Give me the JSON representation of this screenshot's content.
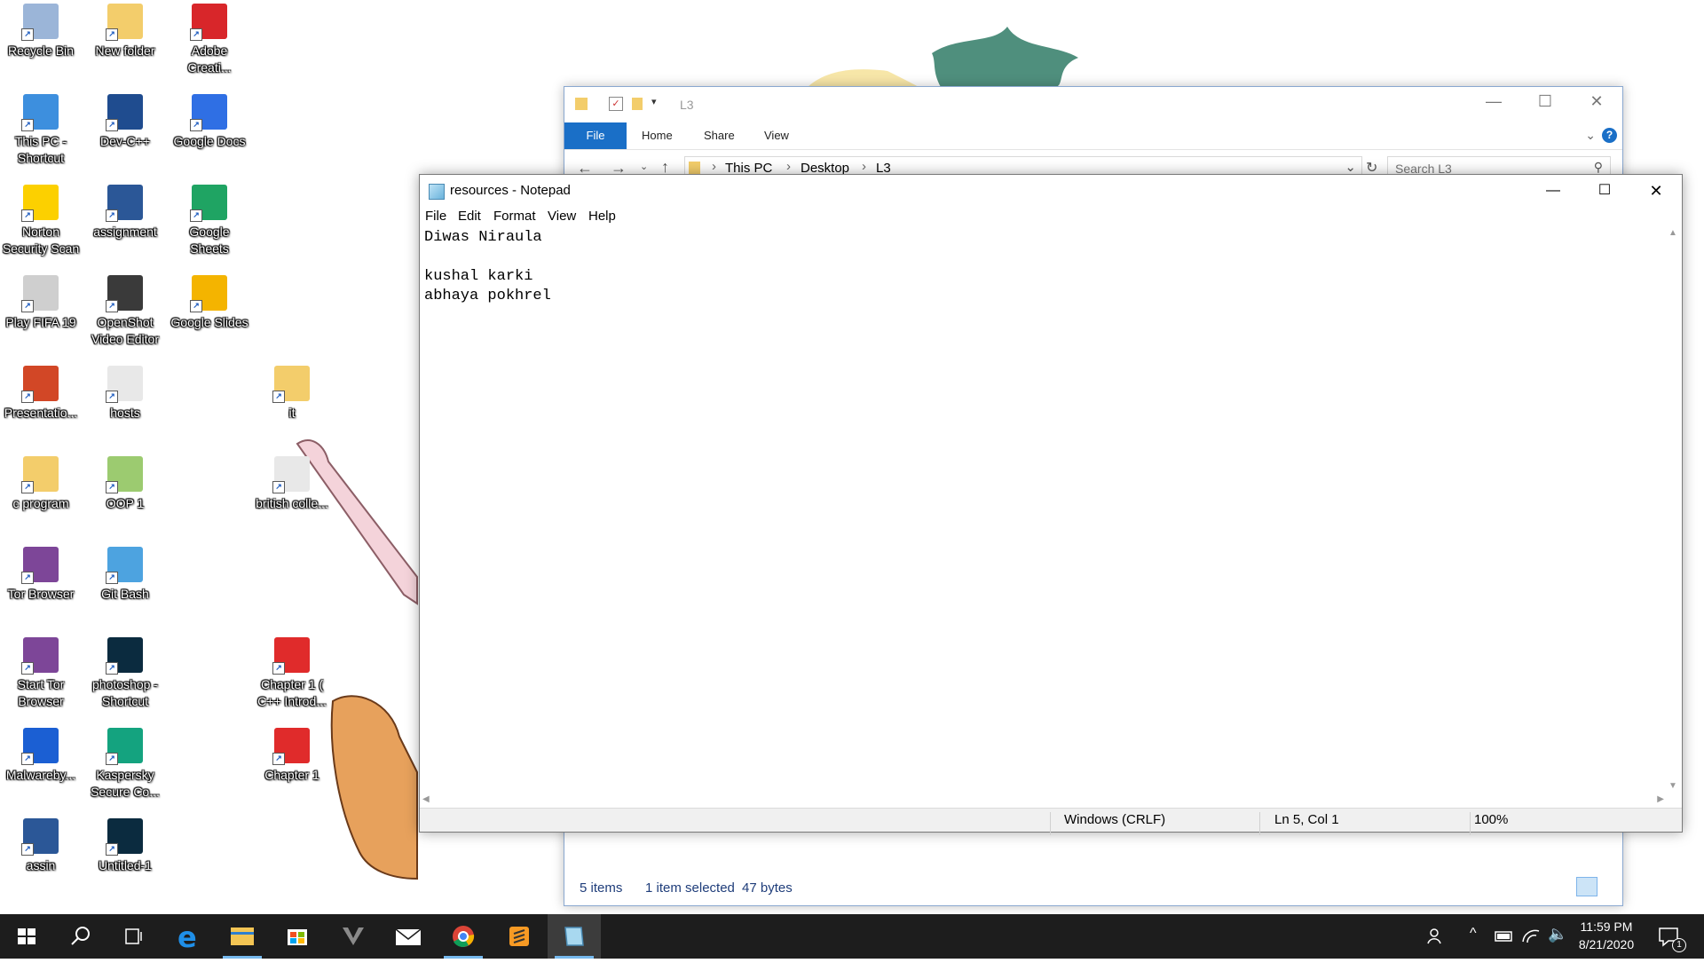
{
  "desktop": {
    "icons": [
      {
        "label": "Recycle Bin",
        "icon": "recycle-bin-icon",
        "color": "#9bb5d8"
      },
      {
        "label": "New folder",
        "icon": "folder-icon",
        "color": "#f3cd6b"
      },
      {
        "label": "Adobe Creati...",
        "icon": "adobe-creative-cloud-icon",
        "color": "#d8262a"
      },
      {
        "label": "This PC - Shortcut",
        "icon": "this-pc-icon",
        "color": "#3d8fde"
      },
      {
        "label": "Dev-C++",
        "icon": "dev-cpp-icon",
        "color": "#1f4c8f"
      },
      {
        "label": "Google Docs",
        "icon": "google-docs-icon",
        "color": "#2f6fe4"
      },
      {
        "label": "Norton Security Scan",
        "icon": "norton-icon",
        "color": "#fcd000"
      },
      {
        "label": "assignment",
        "icon": "word-document-icon",
        "color": "#2b5797"
      },
      {
        "label": "Google Sheets",
        "icon": "google-sheets-icon",
        "color": "#1fa463"
      },
      {
        "label": "Play FIFA 19",
        "icon": "fifa-icon",
        "color": "#cfcfcf"
      },
      {
        "label": "OpenShot Video Editor",
        "icon": "openshot-icon",
        "color": "#3a3a3a"
      },
      {
        "label": "Google Slides",
        "icon": "google-slides-icon",
        "color": "#f4b400"
      },
      {
        "label": "Presentatio...",
        "icon": "powerpoint-icon",
        "color": "#d24726"
      },
      {
        "label": "hosts",
        "icon": "blank-file-icon",
        "color": "#e8e8e8"
      },
      {
        "label": "it",
        "icon": "folder-icon",
        "color": "#f3cd6b"
      },
      {
        "label": "c program",
        "icon": "folder-icon",
        "color": "#f3cd6b"
      },
      {
        "label": "OOP 1",
        "icon": "image-file-icon",
        "color": "#9ccb70"
      },
      {
        "label": "british colle...",
        "icon": "text-file-icon",
        "color": "#e8e8e8"
      },
      {
        "label": "Tor Browser",
        "icon": "tor-browser-icon",
        "color": "#7d4698"
      },
      {
        "label": "Git Bash",
        "icon": "git-bash-icon",
        "color": "#4da3e0"
      },
      {
        "label": "Start Tor Browser",
        "icon": "tor-browser-icon",
        "color": "#7d4698"
      },
      {
        "label": "photoshop - Shortcut",
        "icon": "photoshop-icon",
        "color": "#0b2b3f"
      },
      {
        "label": "Chapter 1 ( C++ Introd...",
        "icon": "pdf-icon",
        "color": "#e02b2b"
      },
      {
        "label": "Malwareby...",
        "icon": "malwarebytes-icon",
        "color": "#1b5fd3"
      },
      {
        "label": "Kaspersky Secure Co...",
        "icon": "kaspersky-icon",
        "color": "#14a37f"
      },
      {
        "label": "Chapter 1",
        "icon": "pdf-icon",
        "color": "#e02b2b"
      },
      {
        "label": "assin",
        "icon": "word-document-icon",
        "color": "#2b5797"
      },
      {
        "label": "Untitled-1",
        "icon": "psd-file-icon",
        "color": "#0b2b3f"
      }
    ]
  },
  "explorer": {
    "title": "L3",
    "ribbon_tabs": [
      "File",
      "Home",
      "Share",
      "View"
    ],
    "breadcrumb": [
      "This PC",
      "Desktop",
      "L3"
    ],
    "search_placeholder": "Search L3",
    "status_items": "5 items",
    "status_selected": "1 item selected",
    "status_size": "47 bytes",
    "accent": "#1a6fc7"
  },
  "notepad": {
    "title": "resources - Notepad",
    "menu": [
      "File",
      "Edit",
      "Format",
      "View",
      "Help"
    ],
    "content": "Diwas Niraula\n\nkushal karki\nabhaya pokhrel\n",
    "status_encoding": "Windows (CRLF)",
    "status_position": "Ln 5, Col 1",
    "status_zoom": "100%"
  },
  "taskbar": {
    "apps": [
      "start-icon",
      "search-icon",
      "task-view-icon",
      "edge-icon",
      "file-explorer-icon",
      "microsoft-store-icon",
      "predator-icon",
      "mail-icon",
      "chrome-icon",
      "sublime-text-icon",
      "notepad-icon"
    ],
    "time": "11:59 PM",
    "date": "8/21/2020",
    "notification_count": "1"
  }
}
